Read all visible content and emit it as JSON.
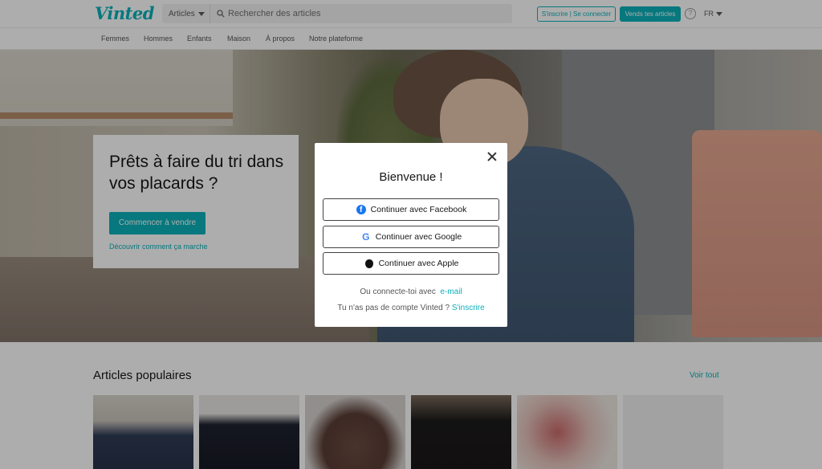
{
  "header": {
    "logo": "Vinted",
    "search_category": "Articles",
    "search_placeholder": "Rechercher des articles",
    "login_label": "S'inscrire | Se connecter",
    "sell_label": "Vends tes articles",
    "help_icon": "question-circle-icon",
    "language": "FR"
  },
  "nav": {
    "categories": [
      "Femmes",
      "Hommes",
      "Enfants",
      "Maison",
      "À propos",
      "Notre plateforme"
    ]
  },
  "hero": {
    "title": "Prêts à faire du tri dans vos placards ?",
    "cta_label": "Commencer à vendre",
    "link_label": "Découvrir comment ça marche"
  },
  "popular": {
    "title": "Articles populaires",
    "see_all": "Voir tout",
    "item_count_visible": 6
  },
  "modal": {
    "title": "Bienvenue !",
    "facebook_label": "Continuer avec Facebook",
    "google_label": "Continuer avec Google",
    "apple_label": "Continuer avec Apple",
    "email_prefix": "Ou connecte-toi avec",
    "email_link": "e-mail",
    "signup_prefix": "Tu n'as pas de compte Vinted ?",
    "signup_link": "S'inscrire"
  },
  "colors": {
    "brand": "#09b1ba",
    "facebook": "#1877f2",
    "overlay": "rgba(0,0,0,0.32)"
  }
}
